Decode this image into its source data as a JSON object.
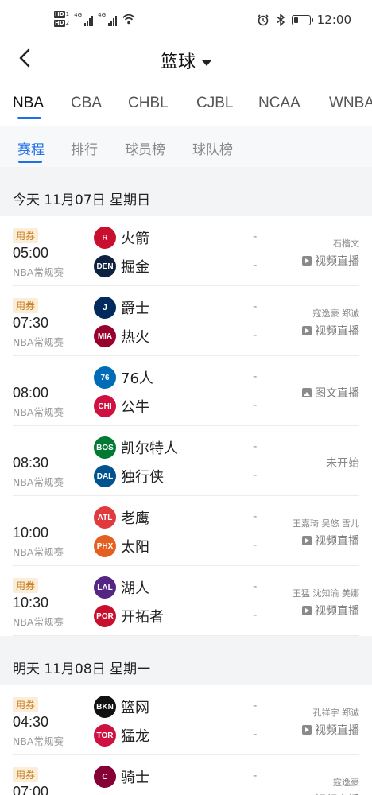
{
  "status_bar": {
    "time": "12:00",
    "sim1": "HD",
    "sim1_slot": "1",
    "sim2": "HD",
    "sim2_slot": "2",
    "net1": "4G",
    "net2": "4G",
    "battery_level": 0.3
  },
  "header": {
    "title": "篮球"
  },
  "league_tabs": [
    "NBA",
    "CBA",
    "CHBL",
    "CJBL",
    "NCAA",
    "WNBA"
  ],
  "league_active": 0,
  "sub_tabs": [
    "赛程",
    "排行",
    "球员榜",
    "球队榜"
  ],
  "sub_active": 0,
  "sections": [
    {
      "date": "今天 11月07日 星期日",
      "matches": [
        {
          "coupon": "用券",
          "time": "05:00",
          "league": "NBA常规赛",
          "home": {
            "name": "火箭",
            "logo": "rockets-logo",
            "color": "#c8102e",
            "abbr": "R"
          },
          "away": {
            "name": "掘金",
            "logo": "nuggets-logo",
            "color": "#0e2240",
            "abbr": "DEN"
          },
          "home_score": "-",
          "away_score": "-",
          "anchors": "石楷文",
          "live": "视频直播",
          "live_icon": "play"
        },
        {
          "coupon": "用券",
          "time": "07:30",
          "league": "NBA常规赛",
          "home": {
            "name": "爵士",
            "logo": "jazz-logo",
            "color": "#002b5c",
            "abbr": "J"
          },
          "away": {
            "name": "热火",
            "logo": "heat-logo",
            "color": "#98002e",
            "abbr": "MIA"
          },
          "home_score": "-",
          "away_score": "-",
          "anchors": "寇逸豪 郑诚",
          "live": "视频直播",
          "live_icon": "play"
        },
        {
          "coupon": "",
          "time": "08:00",
          "league": "NBA常规赛",
          "home": {
            "name": "76人",
            "logo": "76ers-logo",
            "color": "#006bb6",
            "abbr": "76"
          },
          "away": {
            "name": "公牛",
            "logo": "bulls-logo",
            "color": "#ce1141",
            "abbr": "CHI"
          },
          "home_score": "-",
          "away_score": "-",
          "anchors": "",
          "live": "图文直播",
          "live_icon": "picture"
        },
        {
          "coupon": "",
          "time": "08:30",
          "league": "NBA常规赛",
          "home": {
            "name": "凯尔特人",
            "logo": "celtics-logo",
            "color": "#007a33",
            "abbr": "BOS"
          },
          "away": {
            "name": "独行侠",
            "logo": "mavericks-logo",
            "color": "#00538c",
            "abbr": "DAL"
          },
          "home_score": "-",
          "away_score": "-",
          "anchors": "",
          "live": "未开始",
          "live_icon": "none"
        },
        {
          "coupon": "",
          "time": "10:00",
          "league": "NBA常规赛",
          "home": {
            "name": "老鹰",
            "logo": "hawks-logo",
            "color": "#e03a3e",
            "abbr": "ATL"
          },
          "away": {
            "name": "太阳",
            "logo": "suns-logo",
            "color": "#e56020",
            "abbr": "PHX"
          },
          "home_score": "-",
          "away_score": "-",
          "anchors": "王嘉琦 吴悠 雪儿",
          "live": "视频直播",
          "live_icon": "play"
        },
        {
          "coupon": "用券",
          "time": "10:30",
          "league": "NBA常规赛",
          "home": {
            "name": "湖人",
            "logo": "lakers-logo",
            "color": "#552583",
            "abbr": "LAL"
          },
          "away": {
            "name": "开拓者",
            "logo": "blazers-logo",
            "color": "#c8102e",
            "abbr": "POR"
          },
          "home_score": "-",
          "away_score": "-",
          "anchors": "王猛 沈知渝 美娜",
          "live": "视频直播",
          "live_icon": "play"
        }
      ]
    },
    {
      "date": "明天 11月08日 星期一",
      "matches": [
        {
          "coupon": "用券",
          "time": "04:30",
          "league": "NBA常规赛",
          "home": {
            "name": "篮网",
            "logo": "nets-logo",
            "color": "#111111",
            "abbr": "BKN"
          },
          "away": {
            "name": "猛龙",
            "logo": "raptors-logo",
            "color": "#ce1141",
            "abbr": "TOR"
          },
          "home_score": "-",
          "away_score": "-",
          "anchors": "孔祥宇 郑诚",
          "live": "视频直播",
          "live_icon": "play"
        },
        {
          "coupon": "用券",
          "time": "07:00",
          "league": "NBA常规赛",
          "home": {
            "name": "骑士",
            "logo": "cavaliers-logo",
            "color": "#860038",
            "abbr": "C"
          },
          "away": {
            "name": "",
            "logo": "",
            "color": "#ffffff",
            "abbr": ""
          },
          "home_score": "-",
          "away_score": "",
          "anchors": "寇逸豪",
          "live": "视频直播",
          "live_icon": "play"
        }
      ]
    }
  ]
}
